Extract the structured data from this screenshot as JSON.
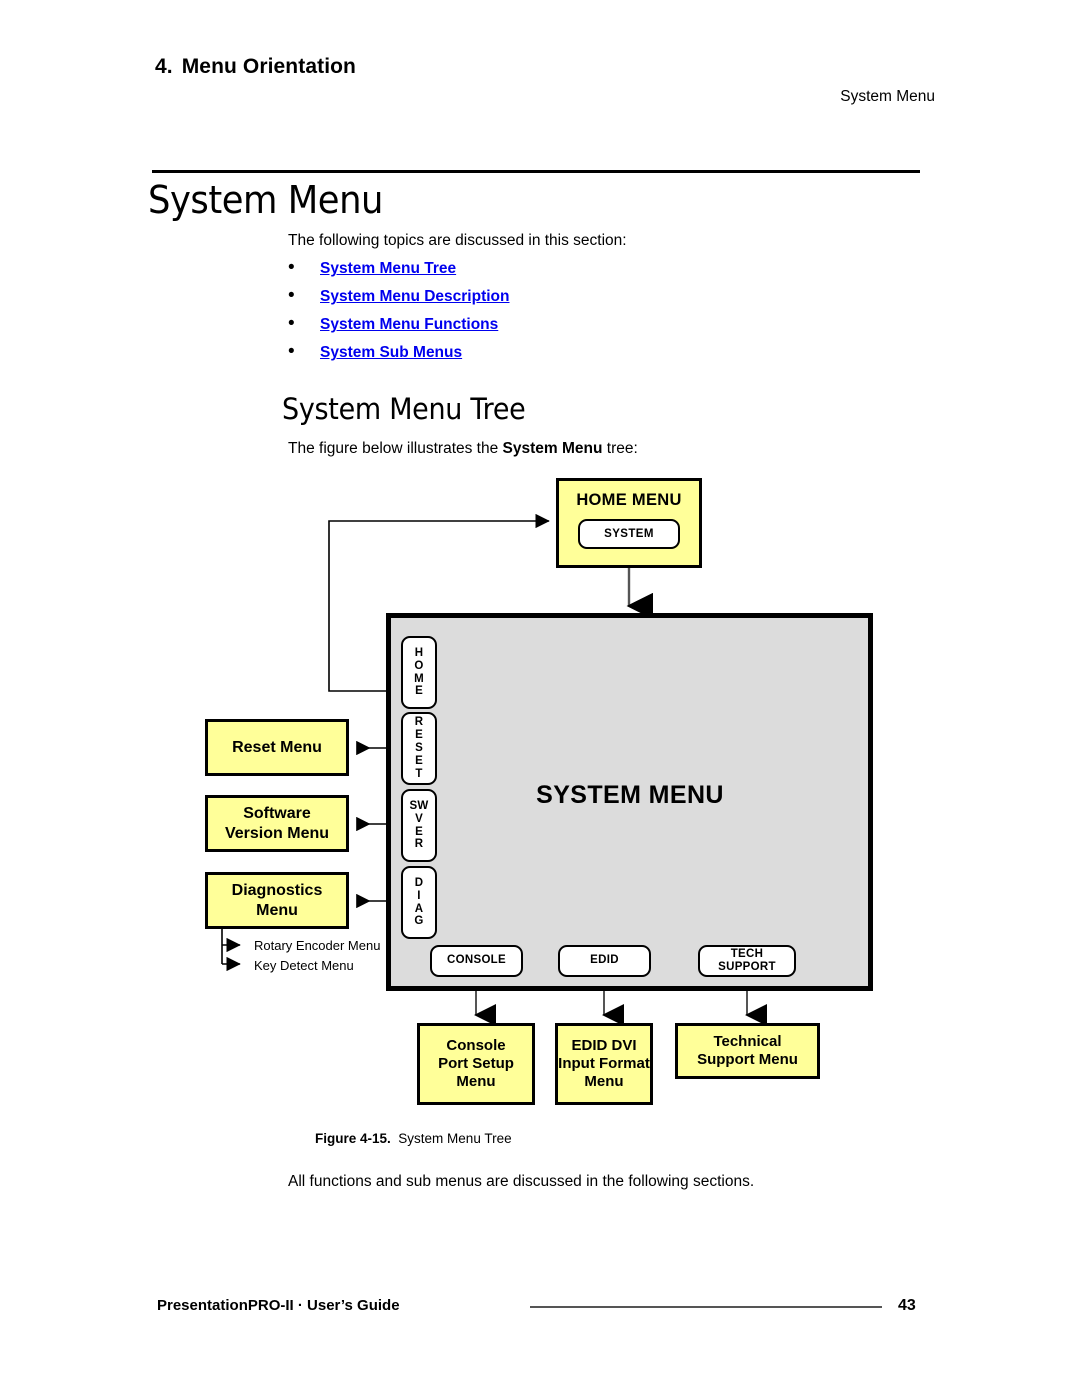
{
  "header": {
    "chapter_number": "4.",
    "chapter_title": "Menu Orientation",
    "running_head": "System Menu"
  },
  "page": {
    "title": "System Menu",
    "intro": "The following topics are discussed in this section:",
    "links": [
      {
        "label": "System Menu Tree"
      },
      {
        "label": "System Menu Description"
      },
      {
        "label": "System Menu Functions"
      },
      {
        "label": "System Sub Menus"
      }
    ],
    "section_title": "System Menu Tree",
    "figure_intro_prefix": "The figure below illustrates the ",
    "figure_intro_bold": "System Menu",
    "figure_intro_suffix": " tree:",
    "figure_caption_label": "Figure 4-15.",
    "figure_caption_text": "System Menu Tree",
    "closing_text": "All functions and sub menus are discussed in the following sections."
  },
  "diagram": {
    "home_menu": {
      "title": "HOME MENU",
      "button": "SYSTEM"
    },
    "system_panel": {
      "label": "SYSTEM MENU",
      "vertical_tabs": [
        {
          "id": "home",
          "lines": [
            "H",
            "O",
            "M",
            "E"
          ]
        },
        {
          "id": "reset",
          "lines": [
            "R",
            "E",
            "S",
            "E",
            "T"
          ]
        },
        {
          "id": "swver",
          "lines": [
            "SW",
            "V",
            "E",
            "R"
          ]
        },
        {
          "id": "diag",
          "lines": [
            "D",
            "I",
            "A",
            "G"
          ]
        }
      ],
      "bottom_buttons": [
        {
          "id": "console",
          "label": "CONSOLE"
        },
        {
          "id": "edid",
          "label": "EDID"
        },
        {
          "id": "tech-support",
          "label": "TECH\nSUPPORT"
        }
      ]
    },
    "left_menus": [
      {
        "id": "reset-menu",
        "label": "Reset Menu"
      },
      {
        "id": "software-version-menu",
        "label": "Software\nVersion Menu"
      },
      {
        "id": "diagnostics-menu",
        "label": "Diagnostics\nMenu"
      }
    ],
    "sub_menus": [
      {
        "id": "rotary-encoder-menu",
        "label": "Rotary Encoder Menu"
      },
      {
        "id": "key-detect-menu",
        "label": "Key Detect Menu"
      }
    ],
    "bottom_menus": [
      {
        "id": "console-port-setup-menu",
        "label": "Console\nPort Setup\nMenu"
      },
      {
        "id": "edid-dvi-input-format-menu",
        "label": "EDID DVI\nInput Format\nMenu"
      },
      {
        "id": "technical-support-menu",
        "label": "Technical\nSupport Menu"
      }
    ],
    "colors": {
      "box_fill": "#FFFF99",
      "panel_fill": "#DCDCDC",
      "border": "#000000",
      "link": "#0000EE"
    }
  },
  "footer": {
    "product": "PresentationPRO-II  ·  User’s Guide",
    "page_number": "43"
  }
}
